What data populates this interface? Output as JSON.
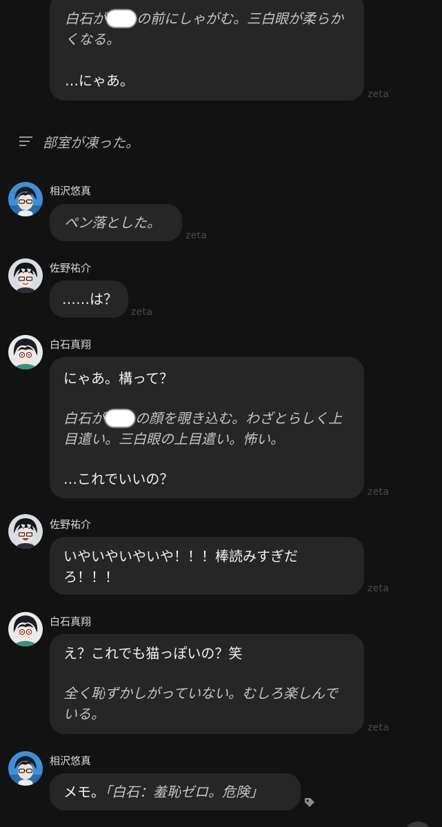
{
  "watermark": "zeta",
  "narration": {
    "text": "部室が凍った。",
    "icon": "menu-lines-icon"
  },
  "messages": [
    {
      "speaker": "",
      "lines": [
        {
          "kind": "action",
          "text": "白石が",
          "text2": "の前にしゃがむ。三白眼が柔らかくなる。"
        },
        {
          "kind": "speech",
          "text": "…にゃあ。"
        }
      ]
    },
    {
      "speaker": "相沢悠真",
      "lines": [
        {
          "kind": "action",
          "text": "ペン落とした。"
        }
      ]
    },
    {
      "speaker": "佐野祐介",
      "lines": [
        {
          "kind": "speech",
          "text": "……は？"
        }
      ]
    },
    {
      "speaker": "白石真翔",
      "lines": [
        {
          "kind": "speech",
          "text": "にゃあ。構って？"
        },
        {
          "kind": "action",
          "text": "白石が",
          "text2": "の顔を覗き込む。わざとらしく上目遣い。三白眼の上目遣い。怖い。"
        },
        {
          "kind": "speech",
          "text": "…これでいいの？"
        }
      ]
    },
    {
      "speaker": "佐野祐介",
      "lines": [
        {
          "kind": "speech",
          "text": "いやいやいやいや！！！棒読みすぎだろ！！！"
        }
      ]
    },
    {
      "speaker": "白石真翔",
      "lines": [
        {
          "kind": "speech",
          "text": "え？これでも猫っぽいの？笑"
        },
        {
          "kind": "action",
          "text": "全く恥ずかしがっていない。むしろ楽しんでいる。"
        }
      ]
    },
    {
      "speaker": "相沢悠真",
      "lines": [
        {
          "kind": "mixed",
          "text": "メモ。",
          "text2": "「白石：羞恥ゼロ。危険」"
        }
      ]
    }
  ],
  "colors": {
    "background": "#121212",
    "bubble": "#262626",
    "action_text": "#c4c4c4"
  }
}
